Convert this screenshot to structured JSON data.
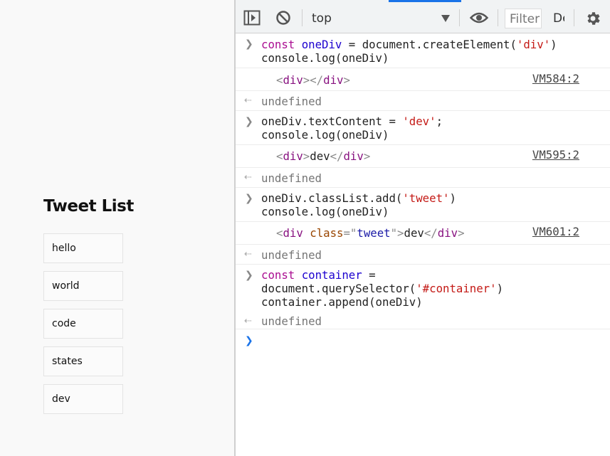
{
  "page": {
    "title": "Tweet List",
    "tweets": [
      "hello",
      "world",
      "code",
      "states",
      "dev"
    ]
  },
  "devtools": {
    "context": "top",
    "filter_placeholder": "Filter",
    "levels_label": "Default levels",
    "icons": [
      "sidebar-toggle-icon",
      "clear-console-icon",
      "chevron-down-icon",
      "eye-icon",
      "gear-icon"
    ],
    "accent_color": "#1a73e8",
    "entries": [
      {
        "input_lines": [
          "const oneDiv = document.createElement('div')",
          "console.log(oneDiv)"
        ],
        "output": "<div></div>",
        "source": "VM584:2",
        "result": "undefined"
      },
      {
        "input_lines": [
          "oneDiv.textContent = 'dev';",
          "console.log(oneDiv)"
        ],
        "output": "<div>dev</div>",
        "source": "VM595:2",
        "result": "undefined"
      },
      {
        "input_lines": [
          "oneDiv.classList.add('tweet')",
          "console.log(oneDiv)"
        ],
        "output": "<div class=\"tweet\">dev</div>",
        "source": "VM601:2",
        "result": "undefined"
      },
      {
        "input_lines": [
          "const container =",
          "document.querySelector('#container')",
          "container.append(oneDiv)"
        ],
        "result": "undefined"
      }
    ],
    "prompt_symbol": ">"
  }
}
